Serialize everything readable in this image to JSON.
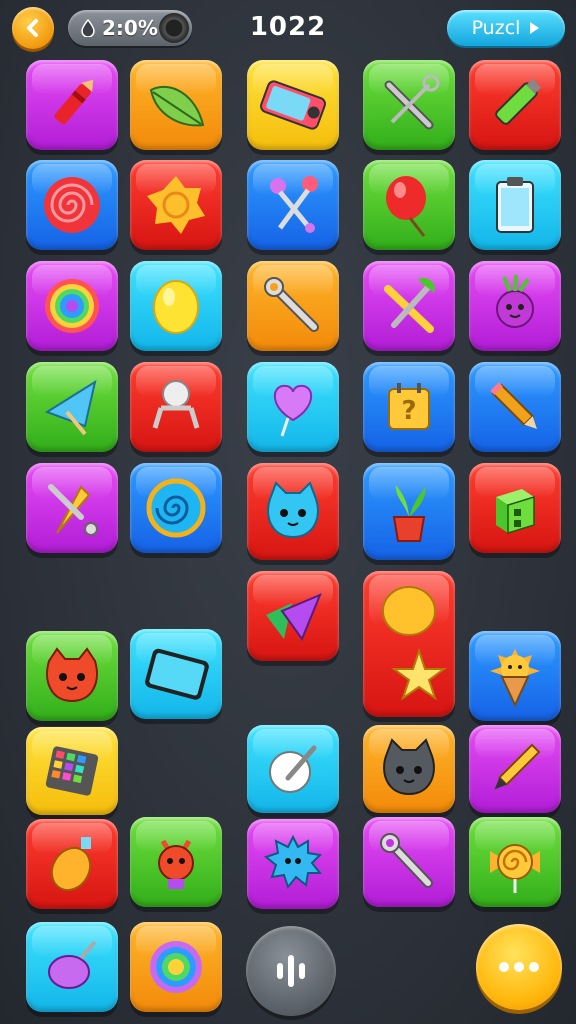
{
  "hud": {
    "timer_value": "2:0%",
    "score": "1022",
    "puzzle_label": "Puzcl"
  },
  "colors": {
    "magenta": "#c62fe6",
    "orange": "#f7a01a",
    "yellow": "#fbd022",
    "green": "#4cc72b",
    "red": "#ec2a20",
    "blue": "#2080f5",
    "cyan": "#28cdf3",
    "background": "#2f343c"
  },
  "tiles": [
    {
      "color": "magenta",
      "icon": "crayon-icon"
    },
    {
      "color": "orange",
      "icon": "leaf-icon"
    },
    {
      "color": "yellow",
      "icon": "phone-icon"
    },
    {
      "color": "green",
      "icon": "tools-icon"
    },
    {
      "color": "red",
      "icon": "marker-icon"
    },
    {
      "color": "blue",
      "icon": "swirl-candy-icon"
    },
    {
      "color": "red",
      "icon": "flower-candy-icon"
    },
    {
      "color": "blue",
      "icon": "scissors-icon"
    },
    {
      "color": "green",
      "icon": "balloon-icon"
    },
    {
      "color": "cyan",
      "icon": "clipboard-icon"
    },
    {
      "color": "magenta",
      "icon": "rainbow-lollipop-icon"
    },
    {
      "color": "cyan",
      "icon": "lemon-icon"
    },
    {
      "color": "orange",
      "icon": "wrench-icon"
    },
    {
      "color": "magenta",
      "icon": "tools-pair-icon"
    },
    {
      "color": "magenta",
      "icon": "beet-creature-icon"
    },
    {
      "color": "green",
      "icon": "umbrella-icon"
    },
    {
      "color": "red",
      "icon": "claw-machine-icon"
    },
    {
      "color": "cyan",
      "icon": "heart-lollipop-icon"
    },
    {
      "color": "blue",
      "icon": "question-box-icon"
    },
    {
      "color": "blue",
      "icon": "pencil-icon"
    },
    {
      "color": "magenta",
      "icon": "wrench-cone-icon"
    },
    {
      "color": "blue",
      "icon": "spiral-icon"
    },
    {
      "color": "red",
      "icon": "cat-face-icon"
    },
    {
      "color": "blue",
      "icon": "potted-plant-icon"
    },
    {
      "color": "red",
      "icon": "cube-icon"
    },
    {
      "color": "red",
      "icon": "triangles-icon"
    },
    {
      "color": "red",
      "icon": "lemon-star-icon"
    },
    {
      "color": "green",
      "icon": "fox-face-icon"
    },
    {
      "color": "cyan",
      "icon": "tablet-icon"
    },
    {
      "color": "blue",
      "icon": "ice-cream-icon"
    },
    {
      "color": "yellow",
      "icon": "palette-icon"
    },
    {
      "color": "cyan",
      "icon": "egg-pen-icon"
    },
    {
      "color": "orange",
      "icon": "gray-cat-icon"
    },
    {
      "color": "magenta",
      "icon": "pen-icon"
    },
    {
      "color": "red",
      "icon": "lemon-drop-icon"
    },
    {
      "color": "green",
      "icon": "devil-creature-icon"
    },
    {
      "color": "magenta",
      "icon": "spiky-creature-icon"
    },
    {
      "color": "magenta",
      "icon": "wrench-icon"
    },
    {
      "color": "green",
      "icon": "candy-swirl-icon"
    },
    {
      "color": "cyan",
      "icon": "top-icon"
    },
    {
      "color": "orange",
      "icon": "rainbow-swirl-icon"
    }
  ],
  "controls": {
    "mic_icon": "waveform-icon",
    "more_icon": "ellipsis-icon"
  }
}
